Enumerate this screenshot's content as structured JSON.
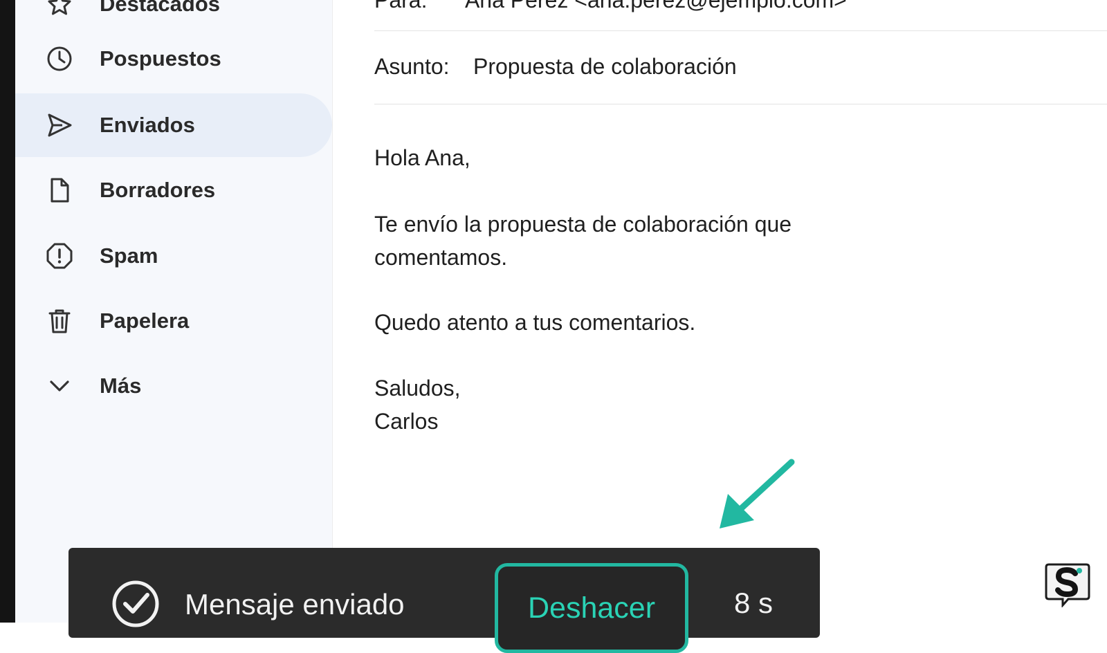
{
  "sidebar": {
    "items": [
      {
        "label": "Destacados",
        "icon": "star-icon"
      },
      {
        "label": "Pospuestos",
        "icon": "clock-icon"
      },
      {
        "label": "Enviados",
        "icon": "send-icon",
        "active": true
      },
      {
        "label": "Borradores",
        "icon": "file-icon"
      },
      {
        "label": "Spam",
        "icon": "alert-icon"
      },
      {
        "label": "Papelera",
        "icon": "trash-icon"
      },
      {
        "label": "Más",
        "icon": "chevron-down-icon"
      }
    ]
  },
  "message": {
    "to_label": "Para:",
    "to_value": "Ana Pérez <ana.perez@ejemplo.com>",
    "subject_label": "Asunto:",
    "subject_value": "Propuesta de colaboración",
    "greeting": "Hola Ana,",
    "body_line1": "Te envío la propuesta de colaboración que",
    "body_line2": "comentamos.",
    "body_line3": "Quedo atento a tus comentarios.",
    "closing": "Saludos,",
    "signature": "Carlos"
  },
  "snackbar": {
    "status_text": "Mensaje enviado",
    "undo_label": "Deshacer",
    "countdown": "8 s"
  },
  "colors": {
    "accent": "#22b8a1",
    "active_nav_bg": "#e8eef8",
    "snackbar_bg": "#2b2b2b"
  }
}
